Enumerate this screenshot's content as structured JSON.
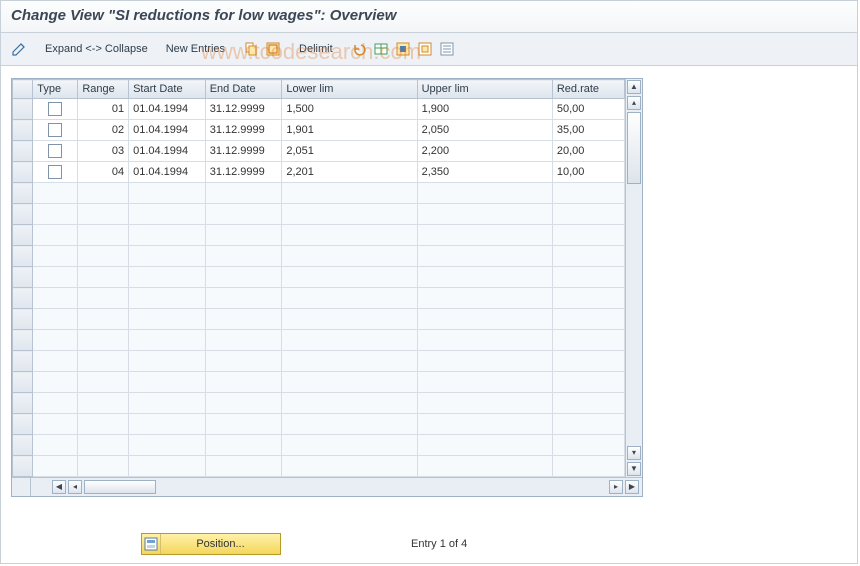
{
  "title": "Change View \"SI reductions for low wages\": Overview",
  "toolbar": {
    "expand": "Expand <-> Collapse",
    "new_entries": "New Entries",
    "delimit": "Delimit"
  },
  "columns": {
    "type": "Type",
    "range": "Range",
    "start": "Start Date",
    "end": "End Date",
    "lower": "Lower lim",
    "upper": "Upper lim",
    "rate": "Red.rate"
  },
  "rows": [
    {
      "range": "01",
      "start": "01.04.1994",
      "end": "31.12.9999",
      "lower": "1,500",
      "upper": "1,900",
      "rate": "50,00"
    },
    {
      "range": "02",
      "start": "01.04.1994",
      "end": "31.12.9999",
      "lower": "1,901",
      "upper": "2,050",
      "rate": "35,00"
    },
    {
      "range": "03",
      "start": "01.04.1994",
      "end": "31.12.9999",
      "lower": "2,051",
      "upper": "2,200",
      "rate": "20,00"
    },
    {
      "range": "04",
      "start": "01.04.1994",
      "end": "31.12.9999",
      "lower": "2,201",
      "upper": "2,350",
      "rate": "10,00"
    }
  ],
  "position_label": "Position...",
  "entry_status": "Entry 1 of 4",
  "watermark": "www.tcodesearch.com"
}
